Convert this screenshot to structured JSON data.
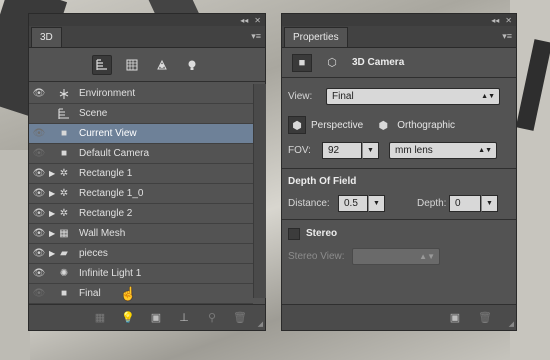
{
  "panel3d": {
    "tab": "3D",
    "filter_icons": [
      "whole-scene-filter-icon",
      "meshes-filter-icon",
      "materials-filter-icon",
      "lights-filter-icon"
    ],
    "layers": [
      {
        "label": "Environment",
        "icon": "environment-icon",
        "eye": "on",
        "arrow": ""
      },
      {
        "label": "Scene",
        "icon": "scene-icon",
        "eye": "off",
        "arrow": ""
      },
      {
        "label": "Current View",
        "icon": "camera-icon",
        "eye": "dim",
        "arrow": "",
        "selected": true
      },
      {
        "label": "Default Camera",
        "icon": "camera-icon",
        "eye": "dim",
        "arrow": ""
      },
      {
        "label": "Rectangle 1",
        "icon": "shape-icon",
        "eye": "on",
        "arrow": "▶"
      },
      {
        "label": "Rectangle 1_0",
        "icon": "shape-icon",
        "eye": "on",
        "arrow": "▶"
      },
      {
        "label": "Rectangle 2",
        "icon": "shape-icon",
        "eye": "on",
        "arrow": "▶"
      },
      {
        "label": "Wall Mesh",
        "icon": "mesh-icon",
        "eye": "on",
        "arrow": "▶"
      },
      {
        "label": "pieces",
        "icon": "folder-icon",
        "eye": "on",
        "arrow": "▶"
      },
      {
        "label": "Infinite Light 1",
        "icon": "light-icon",
        "eye": "on",
        "arrow": ""
      },
      {
        "label": "Final",
        "icon": "camera-icon",
        "eye": "dim",
        "arrow": ""
      }
    ]
  },
  "properties": {
    "tab": "Properties",
    "title": "3D Camera",
    "view_label": "View:",
    "view_value": "Final",
    "perspective_label": "Perspective",
    "orthographic_label": "Orthographic",
    "fov_label": "FOV:",
    "fov_value": "92",
    "lens_value": "mm lens",
    "dof_title": "Depth Of Field",
    "distance_label": "Distance:",
    "distance_value": "0.5",
    "depth_label": "Depth:",
    "depth_value": "0",
    "stereo_label": "Stereo",
    "stereo_view_label": "Stereo View:"
  }
}
